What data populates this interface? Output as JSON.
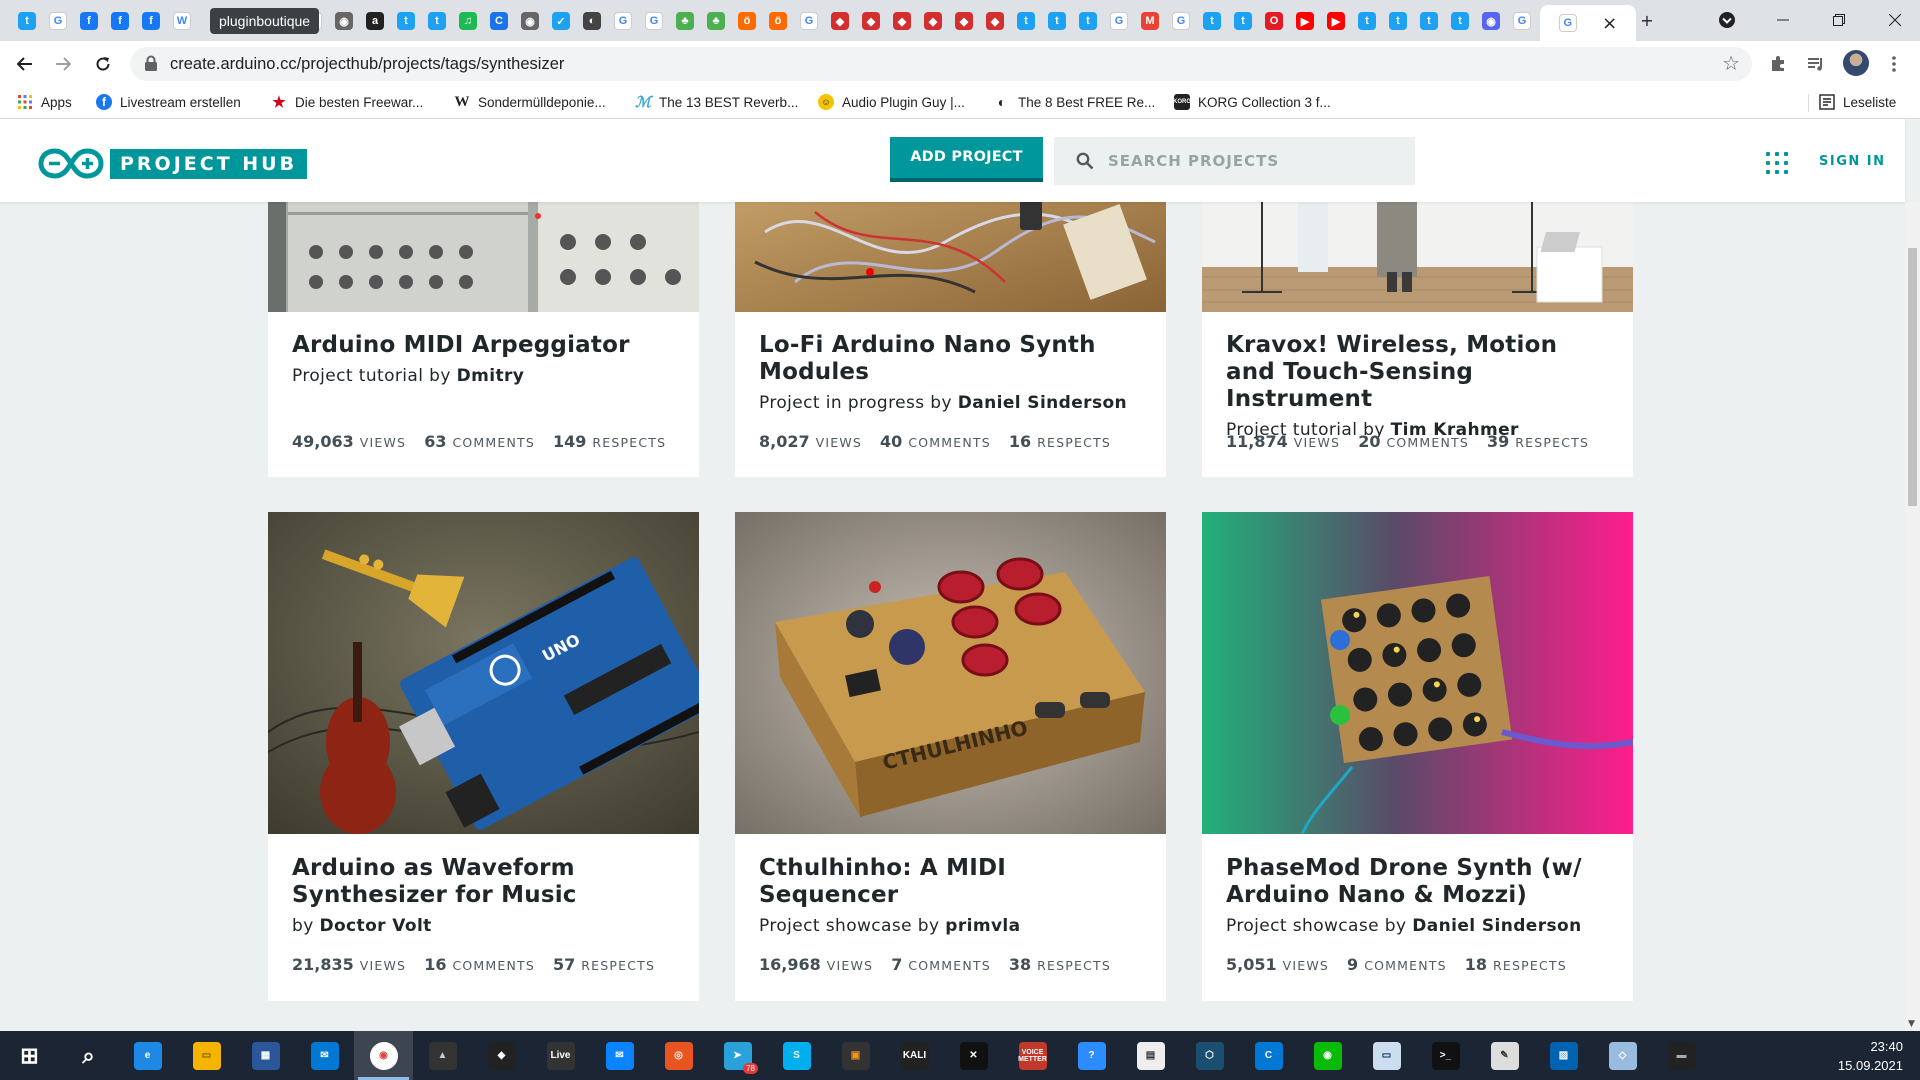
{
  "browser": {
    "tooltip": "pluginboutique",
    "url": "create.arduino.cc/projecthub/projects/tags/synthesizer",
    "tab_icons": [
      "twitter",
      "google",
      "facebook",
      "facebook",
      "facebook",
      "wikipedia",
      "pluginboutique",
      "google",
      "camera",
      "amazon",
      "twitter",
      "twitter",
      "spotify",
      "google-c",
      "camera",
      "twitter-bird",
      "github",
      "google",
      "google",
      "leaf",
      "leaf",
      "soundcloud",
      "soundcloud",
      "google",
      "shield",
      "shield",
      "shield",
      "shield",
      "shield",
      "shield",
      "twitter",
      "twitter",
      "twitter",
      "google",
      "gmail",
      "google",
      "twitter",
      "twitter",
      "opera",
      "youtube",
      "youtube",
      "twitter",
      "twitter",
      "twitter",
      "twitter",
      "discord",
      "google"
    ],
    "active_tab_close": "×",
    "new_tab": "+",
    "bookmarks": [
      {
        "label": "Apps",
        "icon": "apps-grid"
      },
      {
        "label": "Livestream erstellen",
        "icon": "facebook"
      },
      {
        "label": "Die besten Freewar...",
        "icon": "star"
      },
      {
        "label": "Sondermülldeponie...",
        "icon": "w-logo"
      },
      {
        "label": "The 13 BEST Reverb...",
        "icon": "wave"
      },
      {
        "label": "Audio Plugin Guy |...",
        "icon": "guy"
      },
      {
        "label": "The 8 Best FREE Re...",
        "icon": "moon"
      },
      {
        "label": "KORG Collection 3 f...",
        "icon": "korg"
      }
    ],
    "reading_list": "Leseliste"
  },
  "site": {
    "logo_text": "PROJECT HUB",
    "add_project": "ADD PROJECT",
    "search_placeholder": "SEARCH PROJECTS",
    "sign_in": "SIGN IN",
    "accent": "#00979c"
  },
  "projects": [
    {
      "title": "Arduino MIDI Arpeggiator",
      "type": "Project tutorial by ",
      "author": "Dmitry",
      "views": "49,063",
      "comments": "63",
      "respects": "149",
      "image": "synth-rack"
    },
    {
      "title": "Lo-Fi Arduino Nano Synth Modules",
      "type": "Project in progress by ",
      "author": "Daniel Sinderson",
      "views": "8,027",
      "comments": "40",
      "respects": "16",
      "image": "breadboard-wires"
    },
    {
      "title": "Kravox! Wireless, Motion and Touch-Sensing Instrument",
      "type": "Project tutorial by ",
      "author": "Tim Krahmer",
      "views": "11,874",
      "comments": "20",
      "respects": "39",
      "image": "performer-stage"
    },
    {
      "title": "Arduino as Waveform Synthesizer for Music",
      "type": "by ",
      "author": "Doctor Volt",
      "views": "21,835",
      "comments": "16",
      "respects": "57",
      "image": "arduino-uno-instruments"
    },
    {
      "title": "Cthulhinho: A MIDI Sequencer",
      "type": "Project showcase by ",
      "author": "primvla",
      "views": "16,968",
      "comments": "7",
      "respects": "38",
      "image": "wooden-sequencer"
    },
    {
      "title": "PhaseMod Drone Synth (w/ Arduino Nano & Mozzi)",
      "type": "Project showcase by ",
      "author": "Daniel Sinderson",
      "views": "5,051",
      "comments": "9",
      "respects": "18",
      "image": "drone-synth-pcb"
    }
  ],
  "stat_labels": {
    "views": "VIEWS",
    "comments": "COMMENTS",
    "respects": "RESPECTS"
  },
  "taskbar": {
    "time": "23:40",
    "date": "15.09.2021",
    "apps": [
      "start",
      "search",
      "edge",
      "explorer",
      "store",
      "mail",
      "chrome",
      "scanner",
      "inkscape",
      "ableton-live",
      "thunderbird",
      "ubuntu",
      "telegram",
      "skype",
      "fl-studio",
      "kali",
      "x-app",
      "voicemeeter",
      "zoom",
      "app",
      "3d-box",
      "app-c",
      "wechat",
      "app-blue",
      "terminal",
      "notepad",
      "photos",
      "app-flat",
      "app-screen"
    ],
    "telegram_badge": "78",
    "voicemeeter_label": "VOICE METTER",
    "live_label": "Live",
    "kali_label": "KALI"
  }
}
